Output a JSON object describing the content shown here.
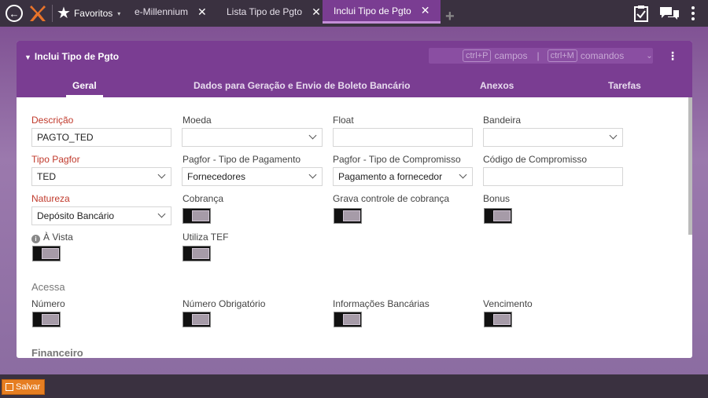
{
  "topbar": {
    "favorites_label": "Favoritos",
    "tabs": [
      {
        "label": "e-Millennium"
      },
      {
        "label": "Lista Tipo de Pgto"
      },
      {
        "label": "Inclui Tipo de Pgto"
      }
    ],
    "close_glyph": "✕",
    "add_glyph": "+"
  },
  "panel": {
    "title": "Inclui Tipo de Pgto",
    "shortcut_campos_key": "ctrl+P",
    "shortcut_campos_label": "campos",
    "shortcut_sep": "|",
    "shortcut_comandos_key": "ctrl+M",
    "shortcut_comandos_label": "comandos",
    "menu_glyph": "⋮",
    "subtabs": [
      {
        "label": "Geral"
      },
      {
        "label": "Dados para Geração e Envio de Boleto Bancário"
      },
      {
        "label": "Anexos"
      },
      {
        "label": "Tarefas"
      }
    ]
  },
  "form": {
    "descricao": {
      "label": "Descrição",
      "value": "PAGTO_TED"
    },
    "moeda": {
      "label": "Moeda",
      "value": ""
    },
    "float": {
      "label": "Float",
      "value": ""
    },
    "bandeira": {
      "label": "Bandeira",
      "value": ""
    },
    "tipo_pagfor": {
      "label": "Tipo Pagfor",
      "value": "TED"
    },
    "pagfor_tipo_pagamento": {
      "label": "Pagfor - Tipo de Pagamento",
      "value": "Fornecedores"
    },
    "pagfor_tipo_compromisso": {
      "label": "Pagfor - Tipo de Compromisso",
      "value": "Pagamento a fornecedor"
    },
    "codigo_compromisso": {
      "label": "Código de Compromisso",
      "value": ""
    },
    "natureza": {
      "label": "Natureza",
      "value": "Depósito Bancário"
    },
    "cobranca": {
      "label": "Cobrança",
      "on": false
    },
    "grava_controle": {
      "label": "Grava controle de cobrança",
      "on": false
    },
    "bonus": {
      "label": "Bonus",
      "on": false
    },
    "a_vista": {
      "label": "À Vista",
      "on": false
    },
    "utiliza_tef": {
      "label": "Utiliza TEF",
      "on": false
    },
    "section_acessa": "Acessa",
    "numero": {
      "label": "Número",
      "on": false
    },
    "numero_obrigatorio": {
      "label": "Número Obrigatório",
      "on": false
    },
    "informacoes_bancarias": {
      "label": "Informações Bancárias",
      "on": false
    },
    "vencimento": {
      "label": "Vencimento",
      "on": false
    },
    "section_financeiro": "Financeiro"
  },
  "bottombar": {
    "save_label": "Salvar"
  },
  "colors": {
    "accent": "#7a3d92",
    "required_label": "#c0392b",
    "save_button": "#e67e22"
  }
}
